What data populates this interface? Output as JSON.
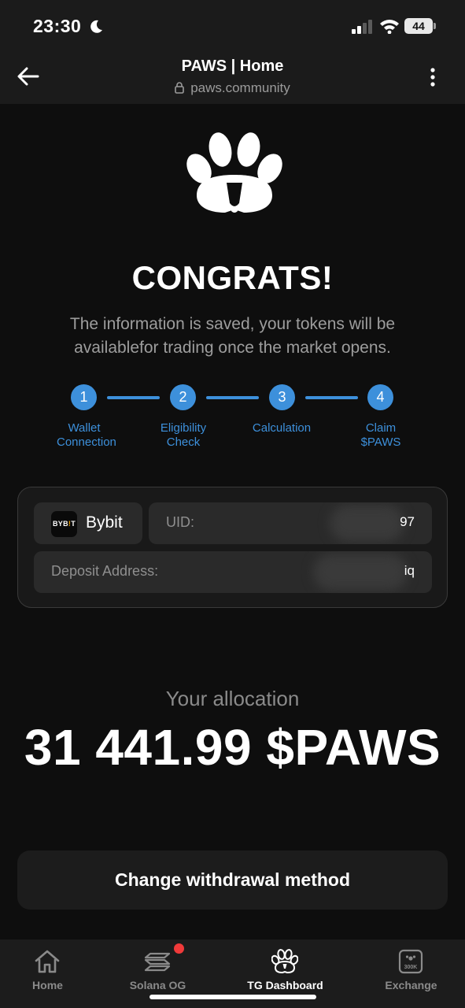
{
  "status_bar": {
    "time": "23:30",
    "battery": "44"
  },
  "browser": {
    "title": "PAWS | Home",
    "url": "paws.community"
  },
  "hero": {
    "title": "CONGRATS!",
    "message": "The information is saved, your tokens will be availablefor trading once the market opens."
  },
  "steps": [
    {
      "number": "1",
      "label": "Wallet Connection"
    },
    {
      "number": "2",
      "label": "Eligibility Check"
    },
    {
      "number": "3",
      "label": "Calculation"
    },
    {
      "number": "4",
      "label": "Claim $PAWS"
    }
  ],
  "exchange": {
    "name": "Bybit",
    "logo_text_a": "BYB",
    "logo_text_b": "!",
    "logo_text_c": "T",
    "uid_label": "UID:",
    "uid_value": "97",
    "deposit_label": "Deposit Address:",
    "deposit_value": "iq"
  },
  "allocation": {
    "label": "Your allocation",
    "value": "31 441.99 $PAWS"
  },
  "actions": {
    "change_withdrawal": "Change withdrawal method"
  },
  "tab_bar": {
    "items": [
      {
        "label": "Home",
        "icon": "home-icon",
        "active": false
      },
      {
        "label": "Solana OG",
        "icon": "solana-icon",
        "active": false,
        "notification": true
      },
      {
        "label": "TG Dashboard",
        "icon": "paw-icon",
        "active": true
      },
      {
        "label": "Exchange",
        "icon": "exchange-300k-icon",
        "active": false
      }
    ],
    "badge_300k": "300K"
  },
  "colors": {
    "background": "#0e0e0e",
    "accent_blue": "#3d90db",
    "notification_red": "#f03a3a",
    "exchange_accent": "#f7a600"
  }
}
